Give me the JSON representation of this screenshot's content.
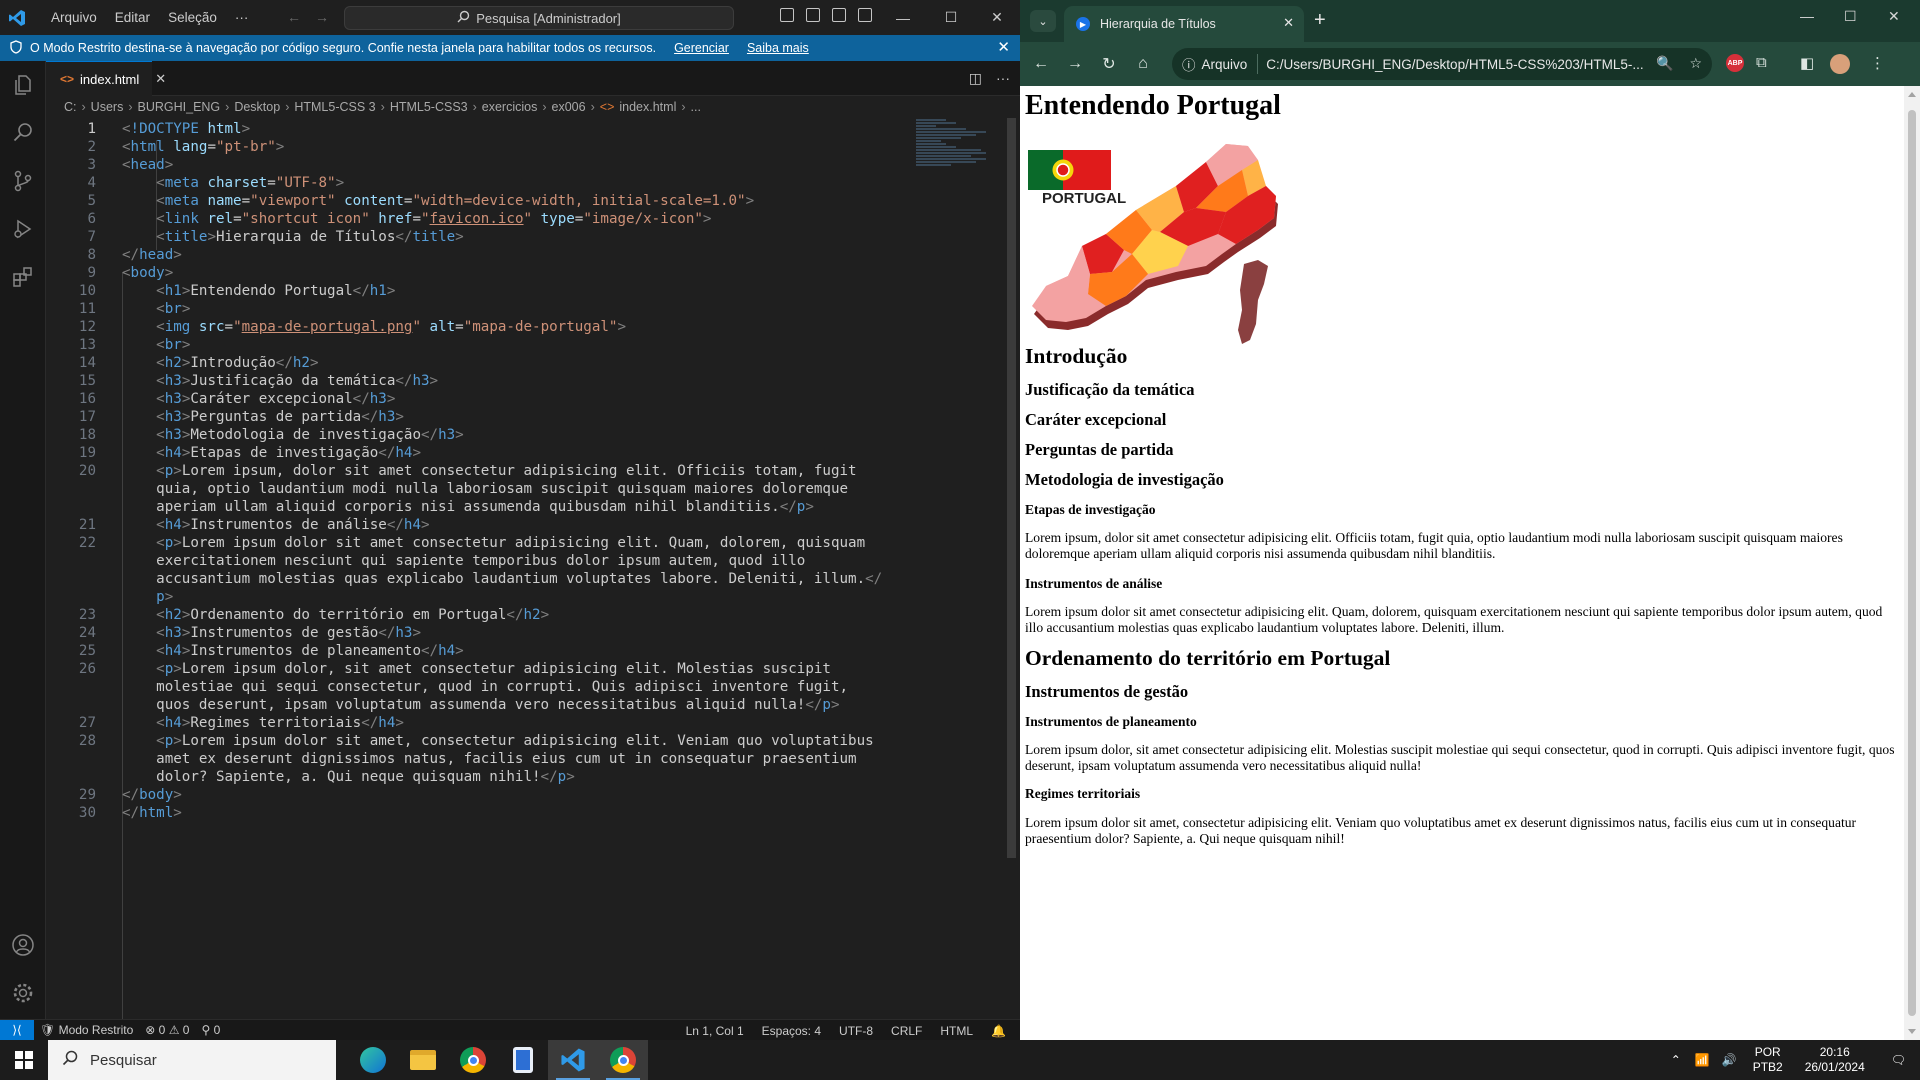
{
  "vscode": {
    "menu": [
      "Arquivo",
      "Editar",
      "Seleção",
      "···"
    ],
    "search_placeholder": "Pesquisa [Administrador]",
    "banner": {
      "text": "O Modo Restrito destina-se à navegação por código seguro. Confie nesta janela para habilitar todos os recursos.",
      "manage": "Gerenciar",
      "learn": "Saiba mais"
    },
    "tab_label": "index.html",
    "breadcrumb": [
      "C:",
      "Users",
      "BURGHI_ENG",
      "Desktop",
      "HTML5-CSS 3",
      "HTML5-CSS3",
      "exercicios",
      "ex006",
      "index.html",
      "..."
    ],
    "status": {
      "restricted": "Modo Restrito",
      "errors": "0",
      "warnings": "0",
      "ports": "0",
      "position": "Ln 1, Col 1",
      "spaces": "Espaços: 4",
      "encoding": "UTF-8",
      "eol": "CRLF",
      "language": "HTML"
    }
  },
  "browser": {
    "tab_title": "Hierarquia de Títulos",
    "scheme_chip": "Arquivo",
    "url": "C:/Users/BURGHI_ENG/Desktop/HTML5-CSS%203/HTML5-...",
    "abp": "ABP",
    "page": {
      "h1": "Entendendo Portugal",
      "map_label": "PORTUGAL",
      "headings": [
        {
          "level": "h2",
          "text": "Introdução"
        },
        {
          "level": "h3",
          "text": "Justificação da temática"
        },
        {
          "level": "h3",
          "text": "Caráter excepcional"
        },
        {
          "level": "h3",
          "text": "Perguntas de partida"
        },
        {
          "level": "h3",
          "text": "Metodologia de investigação"
        },
        {
          "level": "h4",
          "text": "Etapas de investigação"
        },
        {
          "level": "p",
          "text": "Lorem ipsum, dolor sit amet consectetur adipisicing elit. Officiis totam, fugit quia, optio laudantium modi nulla laboriosam suscipit quisquam maiores doloremque aperiam ullam aliquid corporis nisi assumenda quibusdam nihil blanditiis."
        },
        {
          "level": "h4",
          "text": "Instrumentos de análise"
        },
        {
          "level": "p",
          "text": "Lorem ipsum dolor sit amet consectetur adipisicing elit. Quam, dolorem, quisquam exercitationem nesciunt qui sapiente temporibus dolor ipsum autem, quod illo accusantium molestias quas explicabo laudantium voluptates labore. Deleniti, illum."
        },
        {
          "level": "h2",
          "text": "Ordenamento do território em Portugal"
        },
        {
          "level": "h3",
          "text": "Instrumentos de gestão"
        },
        {
          "level": "h4",
          "text": "Instrumentos de planeamento"
        },
        {
          "level": "p",
          "text": "Lorem ipsum dolor, sit amet consectetur adipisicing elit. Molestias suscipit molestiae qui sequi consectetur, quod in corrupti. Quis adipisci inventore fugit, quos deserunt, ipsam voluptatum assumenda vero necessitatibus aliquid nulla!"
        },
        {
          "level": "h4",
          "text": "Regimes territoriais"
        },
        {
          "level": "p",
          "text": "Lorem ipsum dolor sit amet, consectetur adipisicing elit. Veniam quo voluptatibus amet ex deserunt dignissimos natus, facilis eius cum ut in consequatur praesentium dolor? Sapiente, a. Qui neque quisquam nihil!"
        }
      ]
    }
  },
  "taskbar": {
    "search_placeholder": "Pesquisar",
    "lang_top": "POR",
    "lang_bottom": "PTB2",
    "time": "20:16",
    "date": "26/01/2024"
  },
  "code_lines": [
    "1",
    "2",
    "3",
    "4",
    "5",
    "6",
    "7",
    "8",
    "9",
    "10",
    "11",
    "12",
    "13",
    "14",
    "15",
    "16",
    "17",
    "18",
    "19",
    "20",
    "21",
    "22",
    "23",
    "24",
    "25",
    "26",
    "27",
    "28",
    "29",
    "30"
  ]
}
